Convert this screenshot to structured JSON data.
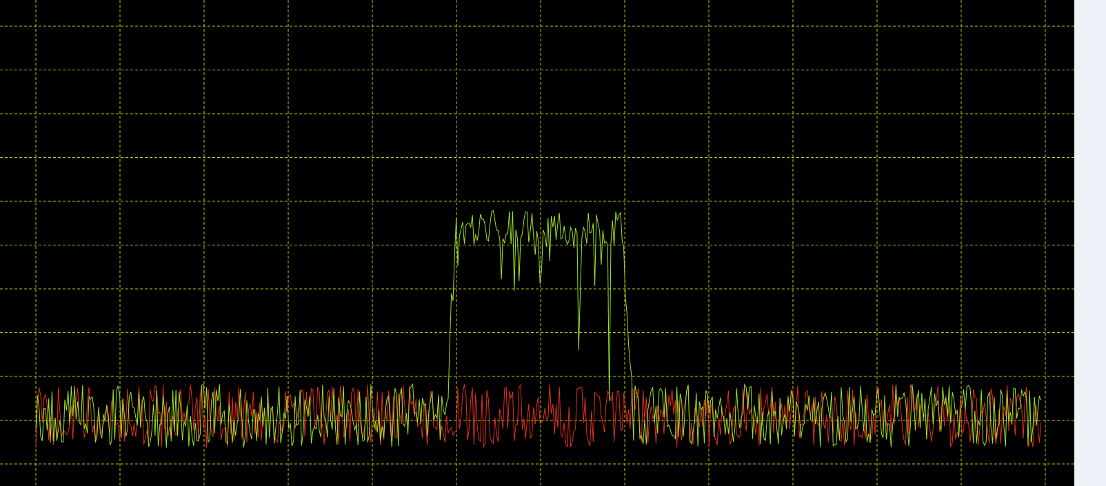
{
  "display": {
    "background_color": "#000000",
    "grid_color": "#c8c800",
    "grid_style": "dashed",
    "panel_color": "#eef1f8"
  },
  "chart_data": {
    "type": "line",
    "title": "",
    "xlabel": "",
    "ylabel": "",
    "grid": true,
    "grid_divisions_x": 13,
    "grid_divisions_y": 11,
    "x_range": [
      0,
      1000
    ],
    "y_range": [
      0,
      11
    ],
    "noise_floor": 0.9,
    "noise_amplitude": 1.5,
    "series": [
      {
        "color": "#9ee51f",
        "channel": {
          "center": 500,
          "half_width": 82,
          "edge_width": 12,
          "top_level": 6.5,
          "top_ripple": 0.9
        },
        "dropouts": [
          {
            "x": 476,
            "level": 4.6
          },
          {
            "x": 510,
            "level": 5.3
          },
          {
            "x": 540,
            "level": 3.2
          },
          {
            "x": 570,
            "level": 2.0
          },
          {
            "x": 402,
            "level": 1.1
          }
        ]
      },
      {
        "color": "#e62e1f",
        "spikes": [
          {
            "x": 500,
            "level": 2.1
          },
          {
            "x": 1011,
            "level": 1.5
          }
        ]
      }
    ]
  }
}
